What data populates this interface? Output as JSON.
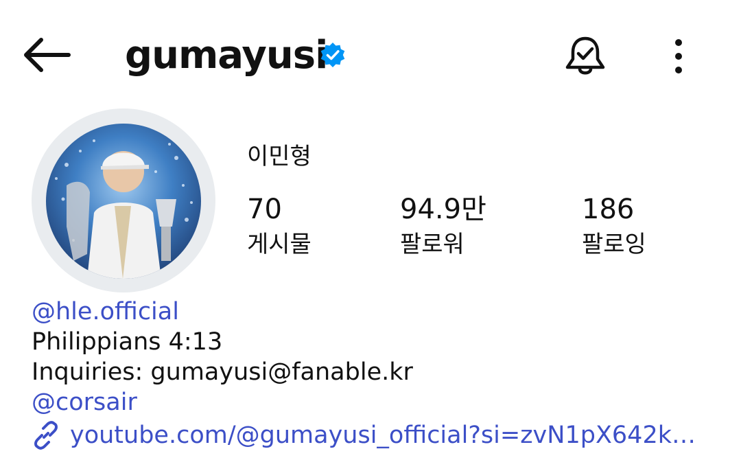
{
  "header": {
    "username": "gumayusi",
    "verified": true,
    "icons": {
      "back": "back-arrow-icon",
      "verified": "verified-badge-icon",
      "notifications": "bell-check-icon",
      "more": "more-vertical-icon"
    }
  },
  "profile": {
    "full_name": "이민형",
    "avatar": "profile-photo"
  },
  "stats": {
    "posts": {
      "value": "70",
      "label": "게시물"
    },
    "followers": {
      "value": "94.9만",
      "label": "팔로워"
    },
    "following": {
      "value": "186",
      "label": "팔로잉"
    }
  },
  "bio": {
    "threads_glyph": "@",
    "mention_1": "hle.official",
    "line_2": "Philippians 4:13",
    "line_3_prefix": "Inquiries: gumayusi",
    "line_3_suffix": "fanable.kr",
    "mention_2": "corsair",
    "link_prefix": "youtube.com/",
    "link_suffix": "gumayusi_official?si=zvN1pX642k…"
  },
  "colors": {
    "accent_link": "#3c4fc7",
    "verified_blue": "#0095f6",
    "avatar_ring": "#e9ecef"
  }
}
